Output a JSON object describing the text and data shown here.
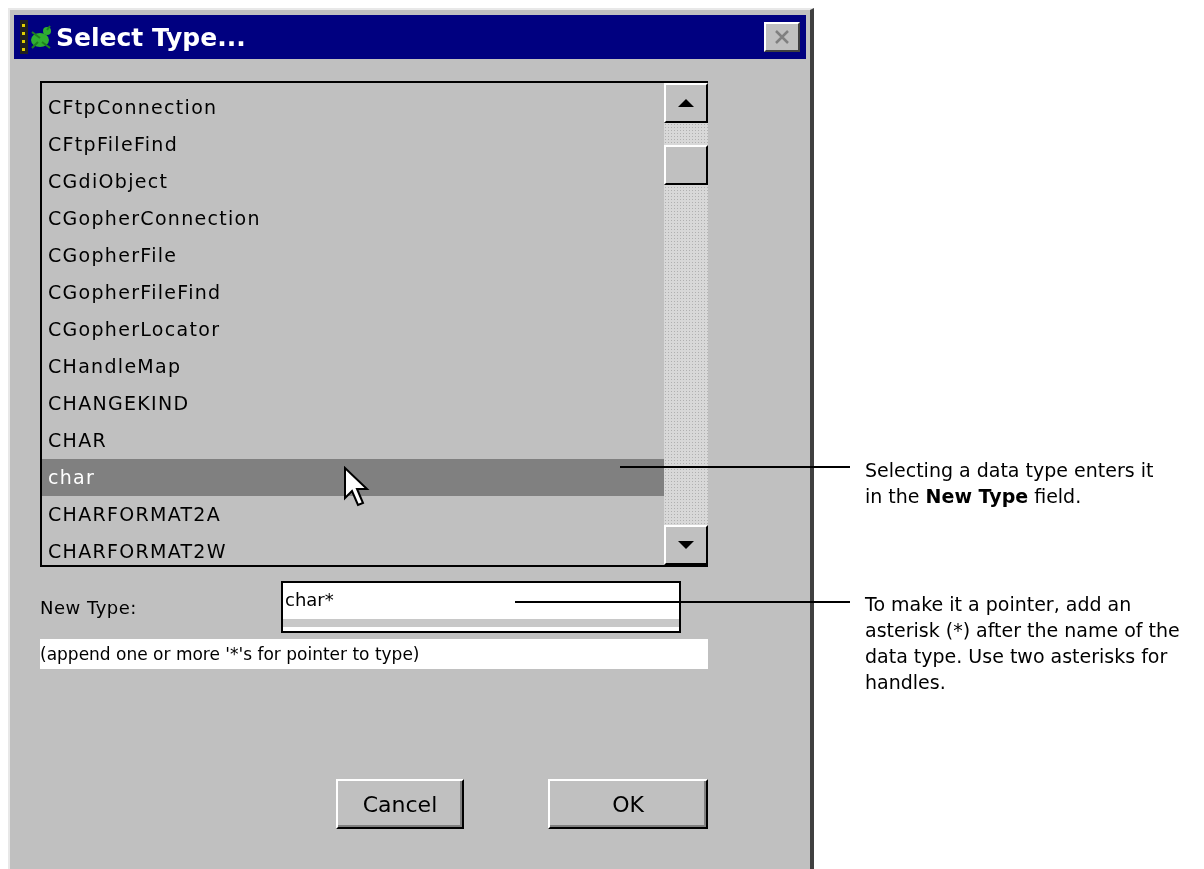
{
  "window": {
    "title": "Select Type..."
  },
  "type_list": {
    "items": [
      {
        "label": "CFtpConnection",
        "selected": false
      },
      {
        "label": "CFtpFileFind",
        "selected": false
      },
      {
        "label": "CGdiObject",
        "selected": false
      },
      {
        "label": "CGopherConnection",
        "selected": false
      },
      {
        "label": "CGopherFile",
        "selected": false
      },
      {
        "label": "CGopherFileFind",
        "selected": false
      },
      {
        "label": "CGopherLocator",
        "selected": false
      },
      {
        "label": "CHandleMap",
        "selected": false
      },
      {
        "label": "CHANGEKIND",
        "selected": false
      },
      {
        "label": "CHAR",
        "selected": false
      },
      {
        "label": "char",
        "selected": true
      },
      {
        "label": "CHARFORMAT2A",
        "selected": false
      },
      {
        "label": "CHARFORMAT2W",
        "selected": false
      }
    ]
  },
  "new_type": {
    "label": "New Type:",
    "value": "char*"
  },
  "hint": "(append one or more '*'s for pointer to type)",
  "buttons": [
    {
      "label": "Cancel"
    },
    {
      "label": "OK"
    }
  ],
  "callouts": [
    {
      "text": "Selecting a data type enters it in the **New Type**  field."
    },
    {
      "text": "To make it a pointer, add an asterisk (*) after the name of the data type. Use two asterisks for handles."
    }
  ]
}
